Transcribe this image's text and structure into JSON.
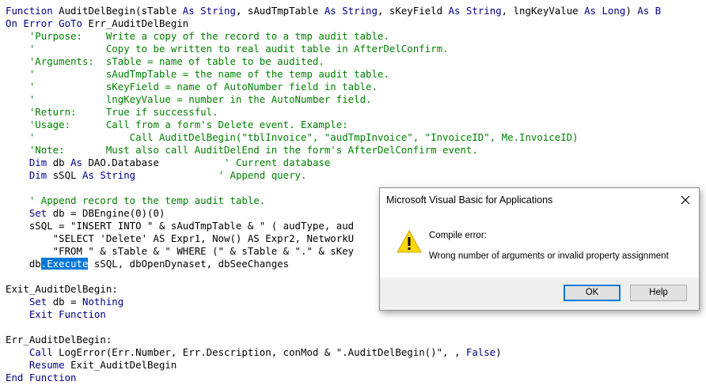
{
  "code_lines": [
    [
      {
        "t": "Function ",
        "c": "kw"
      },
      {
        "t": "AuditDelBegin(sTable "
      },
      {
        "t": "As String",
        "c": "kw"
      },
      {
        "t": ", sAudTmpTable "
      },
      {
        "t": "As String",
        "c": "kw"
      },
      {
        "t": ", sKeyField "
      },
      {
        "t": "As String",
        "c": "kw"
      },
      {
        "t": ", lngKeyValue "
      },
      {
        "t": "As Long",
        "c": "kw"
      },
      {
        "t": ") "
      },
      {
        "t": "As B",
        "c": "kw"
      }
    ],
    [
      {
        "t": "On Error GoTo ",
        "c": "kw"
      },
      {
        "t": "Err_AuditDelBegin"
      }
    ],
    [
      {
        "t": "    'Purpose:    Write a copy of the record to a tmp audit table.",
        "c": "cm"
      }
    ],
    [
      {
        "t": "    '            Copy to be written to real audit table in AfterDelConfirm.",
        "c": "cm"
      }
    ],
    [
      {
        "t": "    'Arguments:  sTable = name of table to be audited.",
        "c": "cm"
      }
    ],
    [
      {
        "t": "    '            sAudTmpTable = the name of the temp audit table.",
        "c": "cm"
      }
    ],
    [
      {
        "t": "    '            sKeyField = name of AutoNumber field in table.",
        "c": "cm"
      }
    ],
    [
      {
        "t": "    '            lngKeyValue = number in the AutoNumber field.",
        "c": "cm"
      }
    ],
    [
      {
        "t": "    'Return:     True if successful.",
        "c": "cm"
      }
    ],
    [
      {
        "t": "    'Usage:      Call from a form's Delete event. Example:",
        "c": "cm"
      }
    ],
    [
      {
        "t": "    '                Call AuditDelBegin(\"tblInvoice\", \"audTmpInvoice\", \"InvoiceID\", Me.InvoiceID)",
        "c": "cm"
      }
    ],
    [
      {
        "t": "    'Note:       Must also call AuditDelEnd in the form's AfterDelConfirm event.",
        "c": "cm"
      }
    ],
    [
      {
        "t": "    "
      },
      {
        "t": "Dim ",
        "c": "kw"
      },
      {
        "t": "db "
      },
      {
        "t": "As ",
        "c": "kw"
      },
      {
        "t": "DAO.Database           "
      },
      {
        "t": "' Current database",
        "c": "cm"
      }
    ],
    [
      {
        "t": "    "
      },
      {
        "t": "Dim ",
        "c": "kw"
      },
      {
        "t": "sSQL "
      },
      {
        "t": "As String",
        "c": "kw"
      },
      {
        "t": "              "
      },
      {
        "t": "' Append query.",
        "c": "cm"
      }
    ],
    [
      {
        "t": ""
      }
    ],
    [
      {
        "t": "    ' Append record to the temp audit table.",
        "c": "cm"
      }
    ],
    [
      {
        "t": "    "
      },
      {
        "t": "Set ",
        "c": "kw"
      },
      {
        "t": "db = DBEngine(0)(0)"
      }
    ],
    [
      {
        "t": "    sSQL = \"INSERT INTO \" & sAudTmpTable & \" ( audType, aud"
      }
    ],
    [
      {
        "t": "        \"SELECT 'Delete' AS Expr1, Now() AS Expr2, NetworkU"
      }
    ],
    [
      {
        "t": "        \"FROM \" & sTable & \" WHERE (\" & sTable & \".\" & sKey"
      }
    ],
    [
      {
        "t": "    db"
      },
      {
        "t": ".Execute",
        "c": "sel"
      },
      {
        "t": " sSQL, dbOpenDynaset, dbSeeChanges"
      }
    ],
    [
      {
        "t": ""
      }
    ],
    [
      {
        "t": "Exit_AuditDelBegin:"
      }
    ],
    [
      {
        "t": "    "
      },
      {
        "t": "Set ",
        "c": "kw"
      },
      {
        "t": "db = "
      },
      {
        "t": "Nothing",
        "c": "kw"
      }
    ],
    [
      {
        "t": "    "
      },
      {
        "t": "Exit Function",
        "c": "kw"
      }
    ],
    [
      {
        "t": ""
      }
    ],
    [
      {
        "t": "Err_AuditDelBegin:"
      }
    ],
    [
      {
        "t": "    "
      },
      {
        "t": "Call ",
        "c": "kw"
      },
      {
        "t": "LogError(Err.Number, Err.Description, conMod & \".AuditDelBegin()\", , "
      },
      {
        "t": "False",
        "c": "kw"
      },
      {
        "t": ")"
      }
    ],
    [
      {
        "t": "    "
      },
      {
        "t": "Resume ",
        "c": "kw"
      },
      {
        "t": "Exit_AuditDelBegin"
      }
    ],
    [
      {
        "t": "End Function",
        "c": "kw"
      }
    ]
  ],
  "colors": {
    "keyword": "#00008b",
    "comment": "#008000",
    "selection": "#0078d7",
    "button_focus": "#0078d7"
  },
  "dialog": {
    "title": "Microsoft Visual Basic for Applications",
    "close_icon": "close-icon",
    "icon": "warning-icon",
    "message_heading": "Compile error:",
    "message_body": "Wrong number of arguments or invalid property assignment",
    "ok_label": "OK",
    "help_label": "Help"
  }
}
